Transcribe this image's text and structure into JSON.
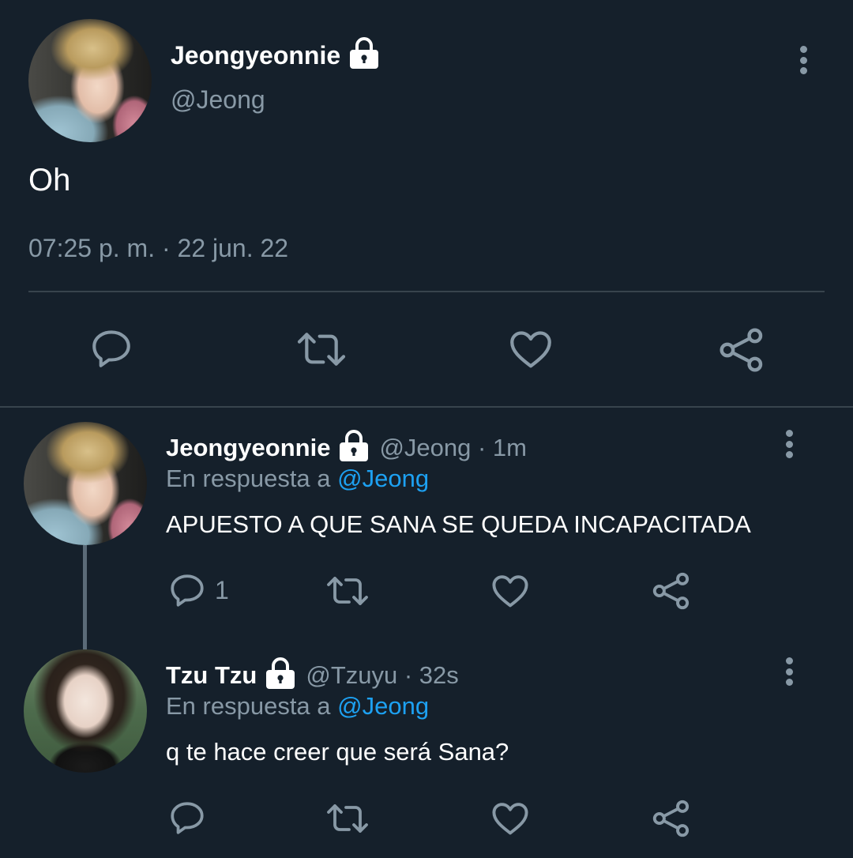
{
  "main_tweet": {
    "display_name": "Jeongyeonnie",
    "handle": "@Jeong",
    "text": "Oh",
    "timestamp": "07:25 p. m. · 22 jun. 22"
  },
  "action_icons": [
    "reply-icon",
    "retweet-icon",
    "like-icon",
    "share-icon"
  ],
  "replies": [
    {
      "display_name": "Jeongyeonnie",
      "meta": "@Jeong · 1m",
      "reply_prefix": "En respuesta a",
      "reply_to": "@Jeong",
      "text": "APUESTO A QUE SANA SE QUEDA INCAPACITADA",
      "reply_count": "1"
    },
    {
      "display_name": "Tzu Tzu",
      "meta": "@Tzuyu · 32s",
      "reply_prefix": "En respuesta a",
      "reply_to": "@Jeong",
      "text": "q te hace creer que será Sana?"
    }
  ],
  "colors": {
    "background": "#15202b",
    "muted": "#8899a6",
    "link": "#1da1f2",
    "divider": "#38444d"
  }
}
